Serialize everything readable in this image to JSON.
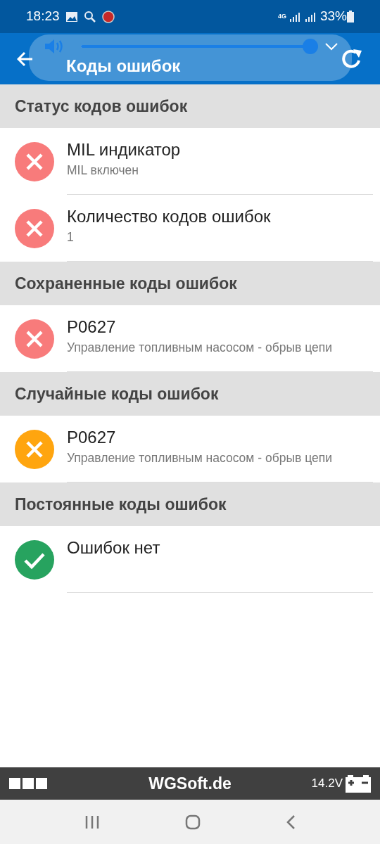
{
  "status_bar": {
    "time": "18:23",
    "network": "4G",
    "battery": "33%"
  },
  "app_bar": {
    "title": "Коды ошибок"
  },
  "volume_overlay": {
    "level": 1
  },
  "sections": [
    {
      "title": "Статус кодов ошибок",
      "items": [
        {
          "kind": "error",
          "title": "MIL индикатор",
          "subtitle": "MIL включен"
        },
        {
          "kind": "error",
          "title": "Количество кодов ошибок",
          "subtitle": "1"
        }
      ]
    },
    {
      "title": "Сохраненные коды ошибок",
      "items": [
        {
          "kind": "error",
          "title": "P0627",
          "subtitle": "Управление топливным насосом - обрыв цепи"
        }
      ]
    },
    {
      "title": "Случайные коды ошибок",
      "items": [
        {
          "kind": "warning",
          "title": "P0627",
          "subtitle": "Управление топливным насосом - обрыв цепи"
        }
      ]
    },
    {
      "title": "Постоянные коды ошибок",
      "items": [
        {
          "kind": "ok",
          "title": "Ошибок нет"
        }
      ]
    }
  ],
  "footer": {
    "brand": "WGSoft.de",
    "voltage": "14.2V"
  }
}
